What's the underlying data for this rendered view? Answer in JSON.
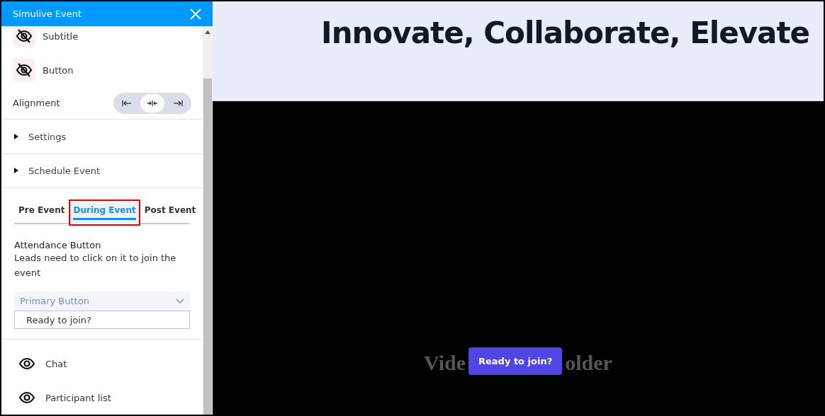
{
  "panel": {
    "title": "Simulive Event",
    "visibility_items": [
      {
        "label": "Subtitle",
        "visible": false
      },
      {
        "label": "Button",
        "visible": false
      }
    ],
    "alignment": {
      "label": "Alignment",
      "options": [
        {
          "kind": "left",
          "selected": false
        },
        {
          "kind": "center",
          "selected": true
        },
        {
          "kind": "right",
          "selected": false
        }
      ]
    },
    "sections": [
      {
        "label": "Settings",
        "expanded": false
      },
      {
        "label": "Schedule Event",
        "expanded": false
      }
    ],
    "tabs": [
      {
        "label": "Pre Event",
        "selected": false,
        "highlighted": false
      },
      {
        "label": "During Event",
        "selected": true,
        "highlighted": true
      },
      {
        "label": "Post Event",
        "selected": false,
        "highlighted": false
      }
    ],
    "attendance": {
      "title": "Attendance Button",
      "description": "Leads need to click on it to join the event",
      "style_select": "Primary Button",
      "button_text": "Ready to join?"
    },
    "features": [
      {
        "label": "Chat",
        "visible": true
      },
      {
        "label": "Participant list",
        "visible": true
      }
    ]
  },
  "preview": {
    "headline": "Innovate, Collaborate, Elevate",
    "placeholder_left": "Vide",
    "join_button": "Ready to join?",
    "placeholder_right": "older"
  }
}
